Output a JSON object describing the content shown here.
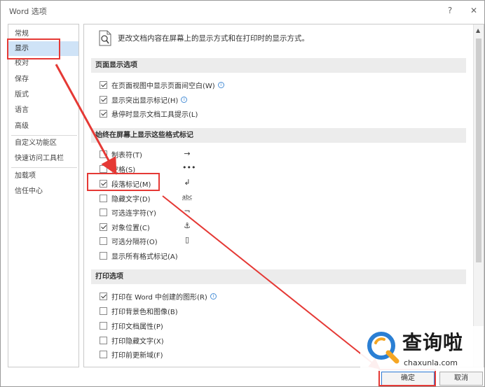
{
  "window": {
    "title": "Word 选项",
    "help_label": "?",
    "close_label": "✕"
  },
  "sidebar": {
    "items": [
      {
        "label": "常规"
      },
      {
        "label": "显示",
        "active": true
      },
      {
        "label": "校对"
      },
      {
        "label": "保存"
      },
      {
        "label": "版式"
      },
      {
        "label": "语言"
      },
      {
        "label": "高级"
      },
      {
        "label": "自定义功能区"
      },
      {
        "label": "快速访问工具栏"
      },
      {
        "label": "加载项"
      },
      {
        "label": "信任中心"
      }
    ]
  },
  "main": {
    "header_icon": "document-magnifier-icon",
    "header_text": "更改文档内容在屏幕上的显示方式和在打印时的显示方式。",
    "sections": [
      {
        "title": "页面显示选项",
        "options": [
          {
            "label": "在页面视图中显示页面间空白(W)",
            "checked": true,
            "info": true
          },
          {
            "label": "显示突出显示标记(H)",
            "checked": true,
            "info": true
          },
          {
            "label": "悬停时显示文档工具提示(L)",
            "checked": true
          }
        ]
      },
      {
        "title": "始终在屏幕上显示这些格式标记",
        "options": [
          {
            "label": "制表符(T)",
            "checked": false,
            "glyph": "→"
          },
          {
            "label": "空格(S)",
            "checked": false,
            "glyph": "•••"
          },
          {
            "label": "段落标记(M)",
            "checked": true,
            "glyph": "↲"
          },
          {
            "label": "隐藏文字(D)",
            "checked": false,
            "glyph": "abc"
          },
          {
            "label": "可选连字符(Y)",
            "checked": false,
            "glyph": "¬"
          },
          {
            "label": "对象位置(C)",
            "checked": true,
            "glyph": "⚓"
          },
          {
            "label": "可选分隔符(O)",
            "checked": false,
            "glyph": "▯"
          },
          {
            "label": "显示所有格式标记(A)",
            "checked": false
          }
        ]
      },
      {
        "title": "打印选项",
        "options": [
          {
            "label": "打印在 Word 中创建的图形(R)",
            "checked": true,
            "info": true
          },
          {
            "label": "打印背景色和图像(B)",
            "checked": false
          },
          {
            "label": "打印文档属性(P)",
            "checked": false
          },
          {
            "label": "打印隐藏文字(X)",
            "checked": false
          },
          {
            "label": "打印前更新域(F)",
            "checked": false
          }
        ]
      }
    ]
  },
  "footer": {
    "ok_label": "确定",
    "cancel_label": "取消"
  },
  "watermark": {
    "brand": "查询啦",
    "domain": "chaxunla.com"
  },
  "colors": {
    "annotation": "#e53935",
    "selection": "#cfe3f7",
    "section_bg": "#ececec"
  }
}
